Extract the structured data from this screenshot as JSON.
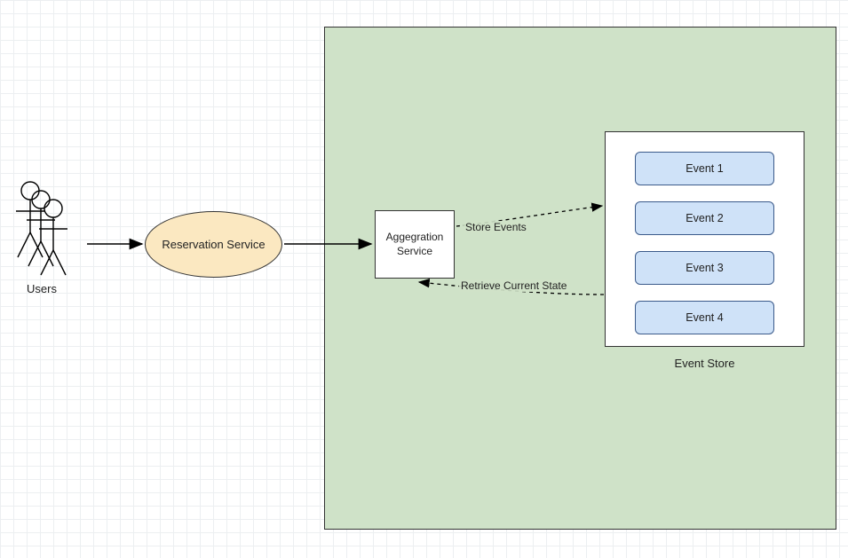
{
  "actors": {
    "users_label": "Users"
  },
  "nodes": {
    "reservation_service": "Reservation Service",
    "aggregation_service": "Aggegration Service",
    "event_store_label": "Event Store"
  },
  "events": [
    {
      "label": "Event 1"
    },
    {
      "label": "Event 2"
    },
    {
      "label": "Event 3"
    },
    {
      "label": "Event 4"
    }
  ],
  "connections": {
    "store_events": "Store Events",
    "retrieve_state": "Retrieve Current State"
  }
}
